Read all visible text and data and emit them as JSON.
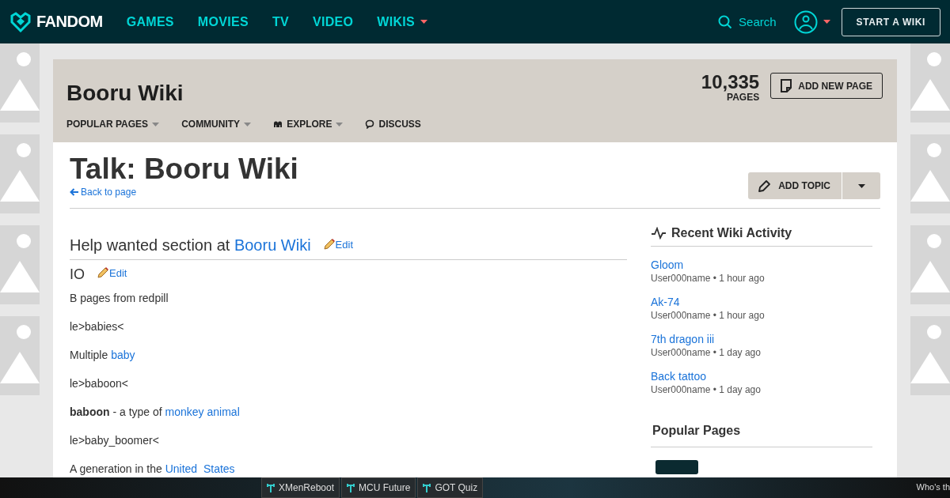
{
  "topnav": {
    "logo": "FANDOM",
    "links": [
      {
        "label": "GAMES",
        "dropdown": false
      },
      {
        "label": "MOVIES",
        "dropdown": false
      },
      {
        "label": "TV",
        "dropdown": false
      },
      {
        "label": "VIDEO",
        "dropdown": false
      },
      {
        "label": "WIKIS",
        "dropdown": true
      }
    ],
    "search": "Search",
    "start_button": "START A WIKI"
  },
  "wiki_header": {
    "title": "Booru Wiki",
    "page_count": "10,335",
    "page_count_label": "PAGES",
    "add_button": "ADD NEW PAGE",
    "menu": [
      {
        "label": "POPULAR PAGES",
        "kind": "plain",
        "dropdown": true
      },
      {
        "label": "COMMUNITY",
        "kind": "plain",
        "dropdown": true
      },
      {
        "label": "EXPLORE",
        "kind": "explore",
        "dropdown": true
      },
      {
        "label": "DISCUSS",
        "kind": "discuss",
        "dropdown": false
      }
    ]
  },
  "page": {
    "title": "Talk: Booru Wiki",
    "back_link": "Back to page",
    "add_topic": "ADD TOPIC"
  },
  "article": {
    "heading": {
      "text": "Help wanted section at ",
      "link": "Booru Wiki",
      "edit": "Edit"
    },
    "subheading": {
      "text": "IO",
      "edit": "Edit"
    },
    "paragraphs": [
      {
        "parts": [
          {
            "kind": "text",
            "text": "B pages from redpill"
          }
        ]
      },
      {
        "parts": [
          {
            "kind": "text",
            "text": "le>babies<"
          }
        ]
      },
      {
        "parts": [
          {
            "kind": "text",
            "text": "Multiple "
          },
          {
            "kind": "link",
            "text": "baby"
          }
        ]
      },
      {
        "parts": [
          {
            "kind": "text",
            "text": "le>baboon<"
          }
        ]
      },
      {
        "parts": [
          {
            "kind": "bold",
            "text": "baboon"
          },
          {
            "kind": "text",
            "text": " - a type of "
          },
          {
            "kind": "link",
            "text": "monkey animal"
          }
        ]
      },
      {
        "parts": [
          {
            "kind": "text",
            "text": "le>baby_boomer<"
          }
        ]
      },
      {
        "parts": [
          {
            "kind": "text",
            "text": "A generation in the "
          },
          {
            "kind": "link",
            "text": "United  States"
          }
        ]
      }
    ]
  },
  "sidebar": {
    "activity_title": "Recent Wiki Activity",
    "activity": [
      {
        "page": "Gloom",
        "meta": "User000name • 1 hour ago"
      },
      {
        "page": "Ak-74",
        "meta": "User000name • 1 hour ago"
      },
      {
        "page": "7th dragon iii",
        "meta": "User000name • 1 day ago"
      },
      {
        "page": "Back tattoo",
        "meta": "User000name • 1 day ago"
      }
    ],
    "popular_title": "Popular Pages"
  },
  "bottom_bar": {
    "items": [
      "XMenReboot",
      "MCU Future",
      "GOT Quiz"
    ],
    "right_text": "Who's th"
  }
}
